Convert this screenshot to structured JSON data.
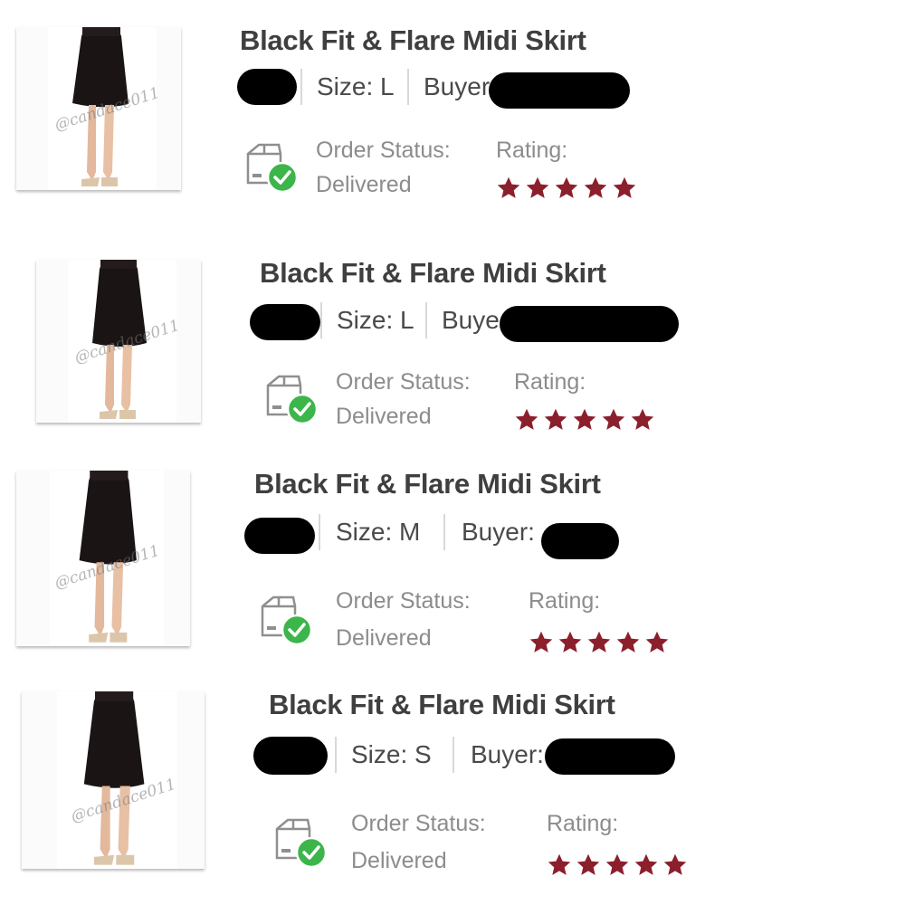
{
  "orders": [
    {
      "title": "Black Fit & Flare Midi Skirt",
      "size": "Size: L",
      "buyer": "Buyer",
      "watermark": "@candace011",
      "status_label": "Order Status:",
      "status": "Delivered",
      "rating_label": "Rating:",
      "rating": 5
    },
    {
      "title": "Black Fit & Flare Midi Skirt",
      "size": "Size: L",
      "buyer": "Buye",
      "watermark": "@candace011",
      "status_label": "Order Status:",
      "status": "Delivered",
      "rating_label": "Rating:",
      "rating": 5
    },
    {
      "title": "Black Fit & Flare Midi Skirt",
      "size": "Size: M",
      "buyer": "Buyer:",
      "watermark": "@candace011",
      "status_label": "Order Status:",
      "status": "Delivered",
      "rating_label": "Rating:",
      "rating": 5
    },
    {
      "title": "Black Fit & Flare Midi Skirt",
      "size": "Size: S",
      "buyer": "Buyer:",
      "watermark": "@candace011",
      "status_label": "Order Status:",
      "status": "Delivered",
      "rating_label": "Rating:",
      "rating": 5
    }
  ],
  "colors": {
    "star": "#8b1f2c",
    "check": "#3cb54a",
    "title": "#3f3f3f",
    "label": "#8c8c8c"
  },
  "icons": {
    "status": "delivered-box-check-icon",
    "rating": "star-icon"
  }
}
